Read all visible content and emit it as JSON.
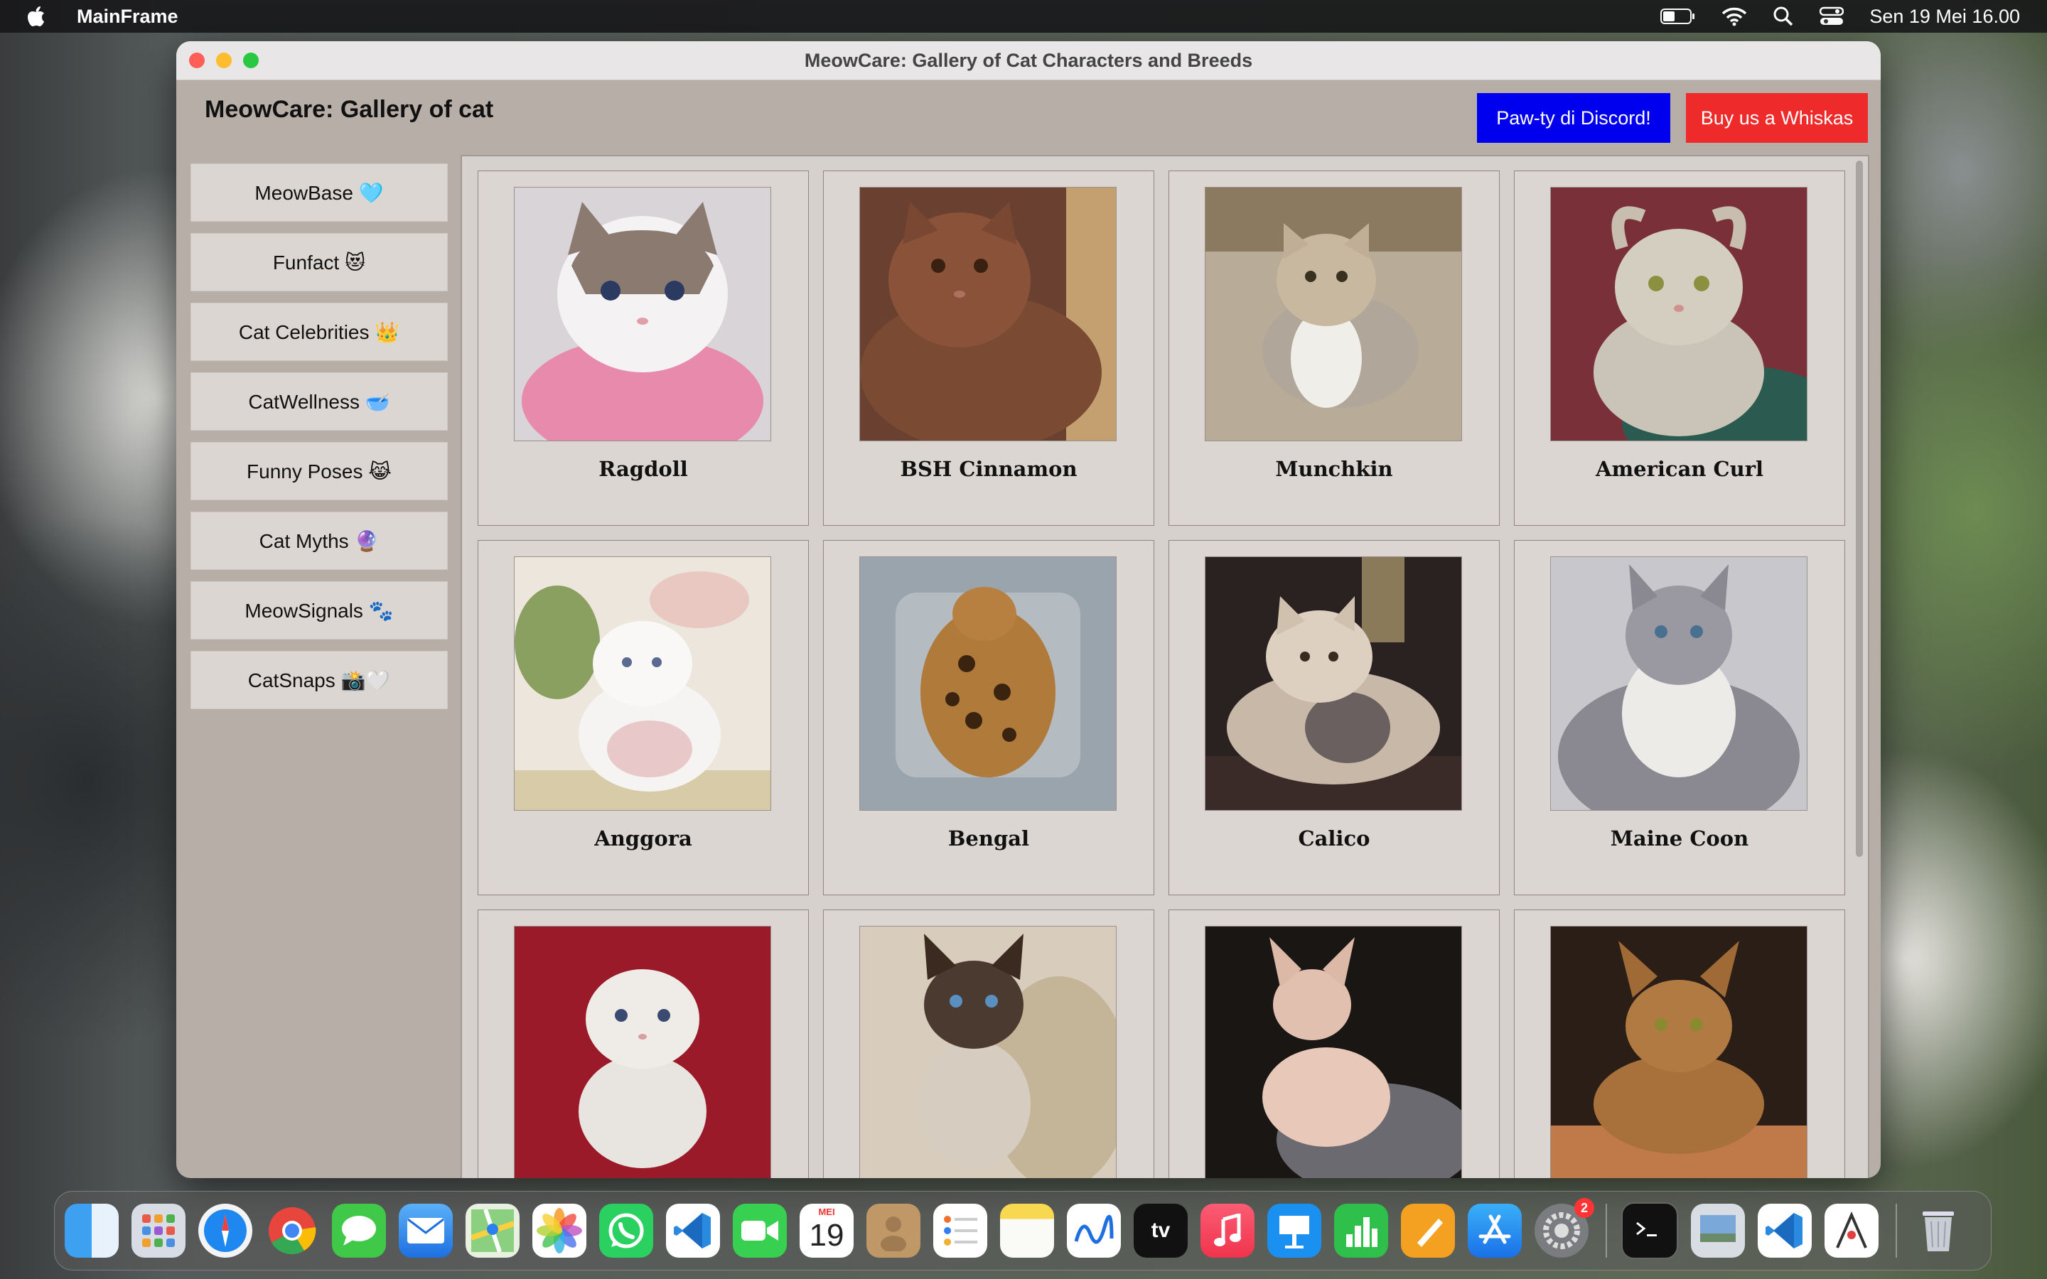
{
  "menubar": {
    "app_name": "MainFrame",
    "clock": "Sen 19 Mei  16.00"
  },
  "window": {
    "title": "MeowCare: Gallery of Cat Characters and Breeds"
  },
  "header": {
    "heading": "MeowCare: Gallery of cat",
    "discord_label": "Paw-ty di Discord!",
    "whiskas_label": "Buy us a Whiskas"
  },
  "sidebar": {
    "items": [
      {
        "label": "MeowBase 🩵"
      },
      {
        "label": "Funfact 😻"
      },
      {
        "label": "Cat Celebrities 👑"
      },
      {
        "label": "CatWellness 🥣"
      },
      {
        "label": "Funny Poses 😹"
      },
      {
        "label": "Cat Myths 🔮"
      },
      {
        "label": "MeowSignals 🐾"
      },
      {
        "label": "CatSnaps 📸🤍"
      }
    ]
  },
  "gallery": {
    "cards": [
      {
        "name": "Ragdoll"
      },
      {
        "name": "BSH Cinnamon"
      },
      {
        "name": "Munchkin"
      },
      {
        "name": "American Curl"
      },
      {
        "name": "Anggora"
      },
      {
        "name": "Bengal"
      },
      {
        "name": "Calico"
      },
      {
        "name": "Maine Coon"
      },
      {
        "name": ""
      },
      {
        "name": ""
      },
      {
        "name": ""
      },
      {
        "name": ""
      }
    ]
  },
  "dock": {
    "calendar_month": "MEI",
    "calendar_day": "19",
    "settings_badge": "2",
    "tv_label": "tv"
  }
}
